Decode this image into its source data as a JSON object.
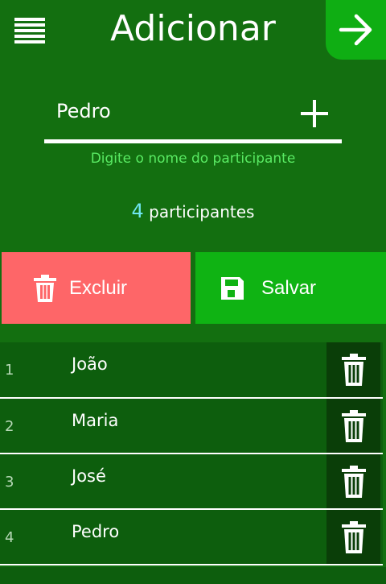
{
  "header": {
    "title": "Adicionar",
    "menu_icon": "hamburger-menu-icon",
    "next_icon": "arrow-right-icon"
  },
  "form": {
    "input_value": "Pedro",
    "helper_text": "Digite o nome do participante",
    "add_icon": "plus-icon"
  },
  "summary": {
    "count": "4",
    "label": "participantes"
  },
  "actions": {
    "delete_label": "Excluir",
    "delete_icon": "trash-icon",
    "save_label": "Salvar",
    "save_icon": "floppy-disk-icon"
  },
  "participants": [
    {
      "index": "1",
      "name": "João"
    },
    {
      "index": "2",
      "name": "Maria"
    },
    {
      "index": "3",
      "name": "José"
    },
    {
      "index": "4",
      "name": "Pedro"
    }
  ],
  "colors": {
    "background": "#136f10",
    "accent": "#0fae13",
    "danger": "#fe6668",
    "row": "#0d5e0d",
    "row_action": "#0a3e08",
    "helper": "#59ea63",
    "count": "#6fe6f0"
  }
}
